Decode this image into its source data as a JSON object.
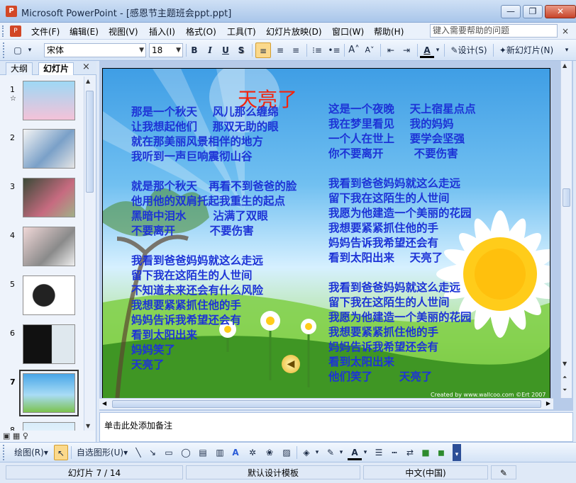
{
  "window": {
    "app_title": "Microsoft PowerPoint - [感恩节主题班会ppt.ppt]",
    "min_label": "—",
    "max_label": "❐",
    "close_label": "✕"
  },
  "menu": {
    "items": [
      "文件(F)",
      "编辑(E)",
      "视图(V)",
      "插入(I)",
      "格式(O)",
      "工具(T)",
      "幻灯片放映(D)",
      "窗口(W)",
      "帮助(H)"
    ],
    "help_placeholder": "键入需要帮助的问题",
    "close": "×"
  },
  "toolbar": {
    "font_name": "宋体",
    "font_size": "18",
    "bold": "B",
    "italic": "I",
    "underline": "U",
    "shadow": "S",
    "design_label": "设计(S)",
    "new_slide_label": "新幻灯片(N)"
  },
  "left_pane": {
    "tab_outline": "大纲",
    "tab_slides": "幻灯片",
    "close": "×",
    "slide_numbers": [
      "1",
      "2",
      "3",
      "4",
      "5",
      "6",
      "7",
      "8"
    ],
    "current_slide": 7
  },
  "slide": {
    "title": "天亮了",
    "left_column": "那是一个秋天    风儿那么缠绵\n让我想起他们    那双无助的眼\n就在那美丽风景相伴的地方\n我听到一声巨响震彻山谷\n\n就是那个秋天   再看不到爸爸的脸\n他用他的双肩托起我重生的起点\n黑暗中泪水       沾满了双眼\n不要离开         不要伤害\n\n我看到爸爸妈妈就这么走远\n留下我在这陌生的人世间\n不知道未来还会有什么风险\n我想要紧紧抓住他的手\n妈妈告诉我希望还会有\n看到太阳出来\n妈妈笑了\n天亮了",
    "right_column": "这是一个夜晚    天上宿星点点\n我在梦里看见    我的妈妈\n一个人在世上    要学会坚强\n你不要离开        不要伤害\n\n我看到爸爸妈妈就这么走远\n留下我在这陌生的人世间\n我愿为他建造一个美丽的花园\n我想要紧紧抓住他的手\n妈妈告诉我希望还会有\n看到太阳出来    天亮了\n\n我看到爸爸妈妈就这么走远\n留下我在这陌生的人世间\n我愿为他建造一个美丽的花园\n我想要紧紧抓住他的手\n妈妈告诉我希望还会有\n看到太阳出来\n他们笑了       天亮了",
    "credit": "Created by www.wallcoo.com  ©Ert 2007"
  },
  "notes": {
    "placeholder": "单击此处添加备注"
  },
  "drawbar": {
    "draw_label": "绘图(R)",
    "autoshape_label": "自选图形(U)"
  },
  "status": {
    "slide_info": "幻灯片 7 / 14",
    "template": "默认设计模板",
    "language": "中文(中国)"
  }
}
